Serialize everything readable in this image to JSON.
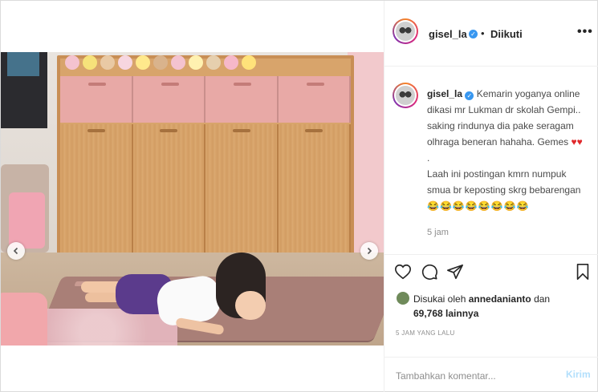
{
  "header": {
    "username": "gisel_la",
    "separator": "•",
    "follow_status": "Diikuti",
    "more": "•••"
  },
  "caption": {
    "username": "gisel_la",
    "lines": [
      "Kemarin yoganya online",
      "dikasi mr Lukman dr skolah Gempi..",
      "saking rindunya dia pake seragam",
      "olhraga beneran hahaha. Gemes"
    ],
    "hearts": "♥♥",
    "dot": ".",
    "lines2": [
      "Laah ini postingan kmrn numpuk",
      "smua br keposting skrg bebarengan"
    ],
    "emojis": "😂😂😂😂😂😂😂😂",
    "time": "5 jam"
  },
  "likes": {
    "prefix": "Disukai oleh",
    "user": "annedanianto",
    "mid": "dan",
    "count": "69,768",
    "suffix": "lainnya"
  },
  "post_age": "5 JAM YANG LALU",
  "comment": {
    "placeholder": "Tambahkan komentar...",
    "post_label": "Kirim"
  },
  "carousel": {
    "total": 4,
    "active_index": 0
  },
  "icons": {
    "verified": "verified-badge-icon",
    "like": "heart-outline-icon",
    "comment": "speech-bubble-icon",
    "share": "paper-plane-icon",
    "save": "bookmark-icon",
    "prev": "chevron-left-icon",
    "next": "chevron-right-icon"
  },
  "colors": {
    "verified": "#3897f0",
    "post_button_disabled": "#b2dffc",
    "heart": "#e0282b"
  }
}
